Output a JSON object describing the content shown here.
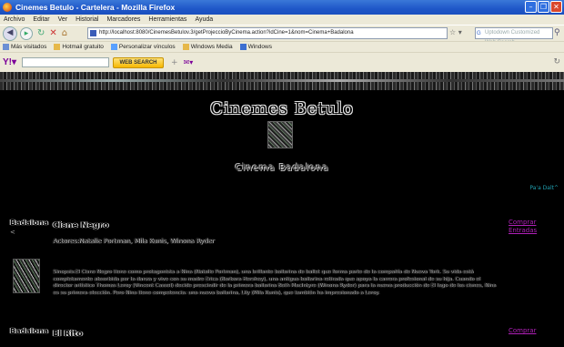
{
  "window": {
    "title": "Cinemes Betulo - Cartelera - Mozilla Firefox"
  },
  "menu": [
    "Archivo",
    "Editar",
    "Ver",
    "Historial",
    "Marcadores",
    "Herramientas",
    "Ayuda"
  ],
  "nav": {
    "url": "http://localhost:8080/CinemesBetulov.3/getProjeccioByCinema.action?idCine=1&nom=Cinema+Badalona",
    "search_placeholder": "Uptodown Customized Web Search"
  },
  "bookmarks": [
    "Más visitados",
    "Hotmail gratuito",
    "Personalizar vínculos",
    "Windows Media",
    "Windows"
  ],
  "yahoo_toolbar": {
    "search_button": "WEB SEARCH"
  },
  "page": {
    "hero_title": "Cinemes Betulo",
    "cinema_name": "Cinema Badalona",
    "go_top": "Pa'a Dalt^",
    "films": [
      {
        "city": "Badalona",
        "arrow": "<",
        "title": "Cisne Negro",
        "actors": "Actores:Natalie Portman, Mila Kunis, Winona Ryder",
        "synopsis": "Sinopsis:El Cisne Negro tiene como protagonista a Nina (Natalie Portman), una brillante bailarina de ballet que forma parte de la compañía de Nueva York. Su vida está completamente absorbida por la danza y vive con su madre Erica (Barbara Hershey), una antigua bailarina retirada que apoya la carrera profesional de su hija. Cuando el director artístico Thomas Leroy (Vincent Cassel) decide prescindir de la primera bailarina Beth MacIntyre (Winona Ryder) para la nueva producción de El lago de los cisnes, Nina es su primera elección. Pero Nina tiene competencia: una nueva bailarina, Lily (Mila Kunis), que también ha impresionado a Leroy.",
        "links": [
          "Comprar",
          "Entradas"
        ]
      },
      {
        "city": "Badalona",
        "title": "El Rito",
        "links": [
          "Comprar"
        ]
      }
    ]
  }
}
